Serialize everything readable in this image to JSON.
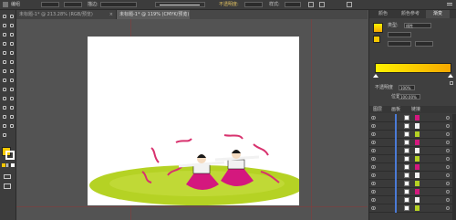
{
  "control_bar": {
    "label_no_selection": "编组",
    "label_opacity": "不透明度:",
    "opacity_value": "100%",
    "label_style": "样式:",
    "label_stroke": "描边:"
  },
  "tabs": [
    {
      "label": "未标题-1* @ 213.28% (RGB/预览)",
      "close": "×"
    },
    {
      "label": "未标题-1* @ 119% (CMYK/预览)",
      "close": "×"
    }
  ],
  "right_panel": {
    "tabs": [
      "颜色",
      "颜色参考",
      "渐变"
    ],
    "type_label": "类型:",
    "type_value": "线性",
    "opacity_label": "不透明度",
    "opacity_value": "100%",
    "location_label": "位置",
    "location_value": "100.00%",
    "layers_tabs": [
      "图层",
      "画板",
      "链接"
    ]
  },
  "colors": {
    "fill": "#f7c800",
    "gradient_start": "#fff200",
    "gradient_end": "#f6a800",
    "ground": "#b5d224",
    "skirt": "#d4187e"
  },
  "icons": [
    "selection-tool-icon",
    "direct-selection-icon",
    "magic-wand-icon",
    "lasso-icon",
    "pen-icon",
    "type-icon",
    "line-icon",
    "rectangle-icon",
    "paintbrush-icon",
    "pencil-icon",
    "eraser-icon",
    "rotate-icon",
    "scale-icon",
    "warp-icon",
    "free-transform-icon",
    "shape-builder-icon",
    "perspective-icon",
    "mesh-icon",
    "gradient-icon",
    "eyedropper-icon",
    "blend-icon",
    "symbol-sprayer-icon",
    "column-graph-icon",
    "artboard-icon",
    "slice-icon",
    "hand-icon",
    "zoom-icon"
  ]
}
